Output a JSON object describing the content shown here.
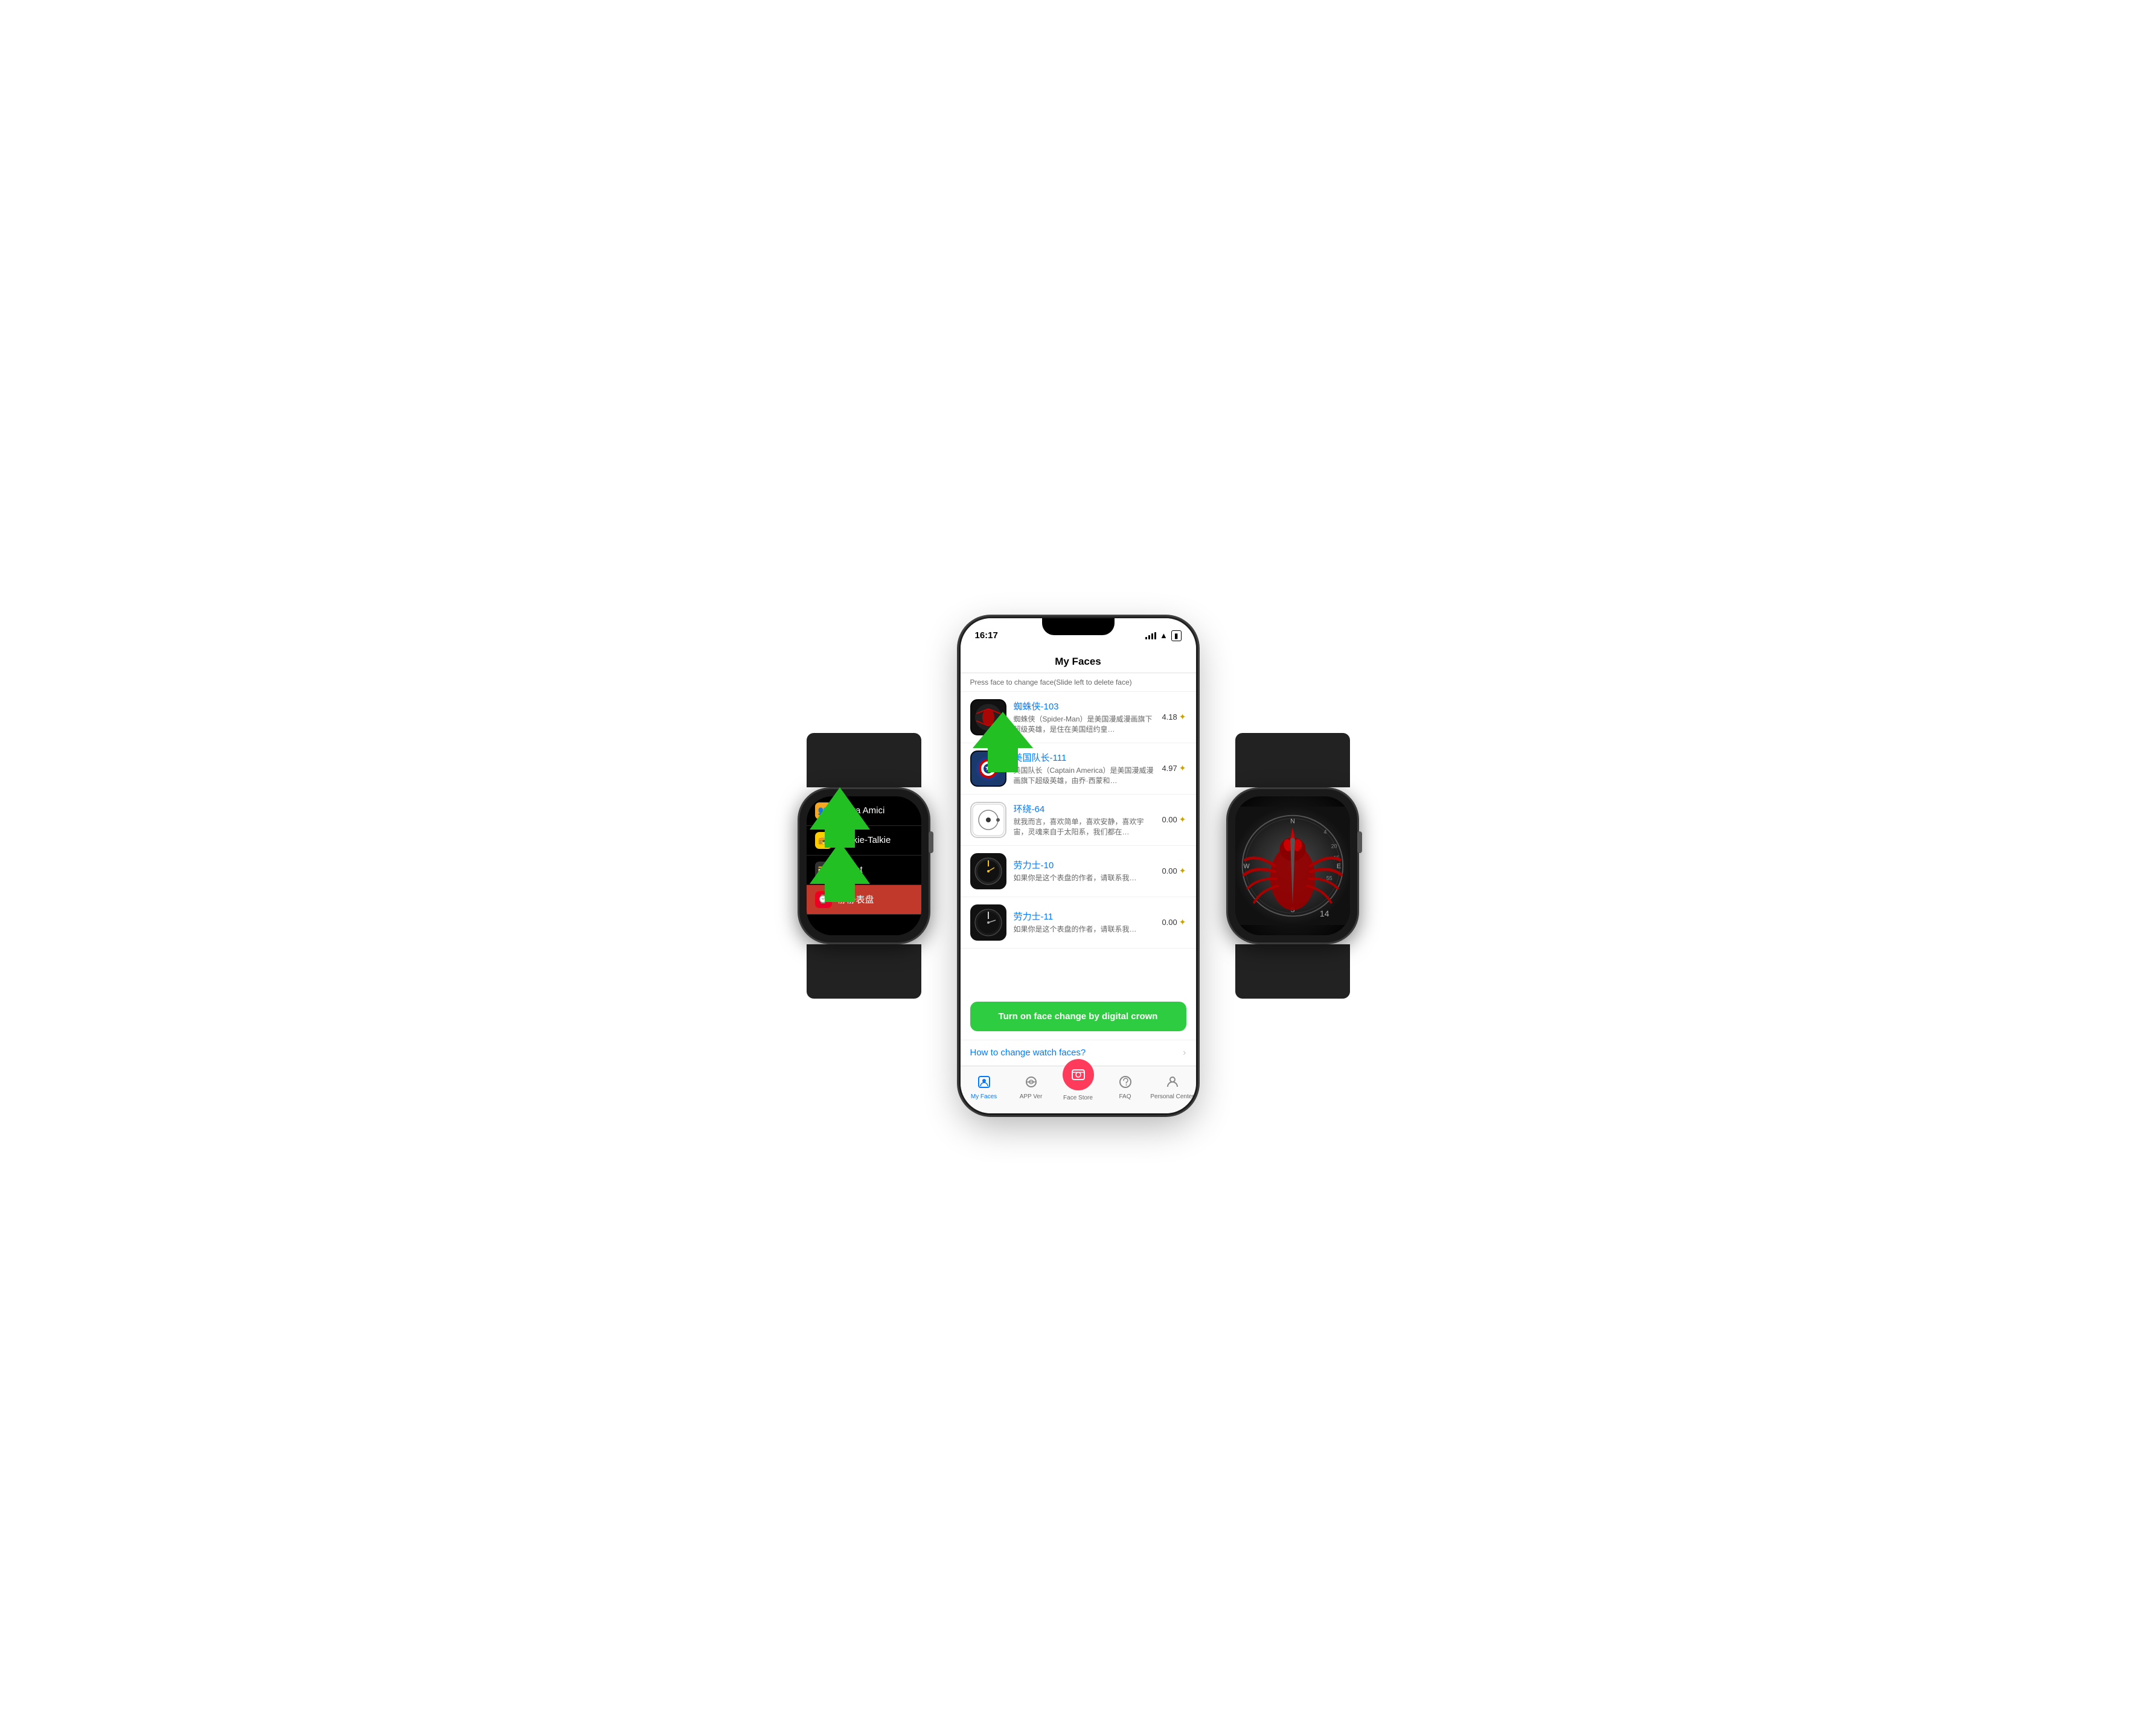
{
  "status_bar": {
    "time": "16:17",
    "signal": "●●●",
    "wifi": "wifi",
    "battery": "battery"
  },
  "page": {
    "title": "My Faces",
    "subtitle": "Press face to change face(Slide left to delete face)"
  },
  "faces": [
    {
      "id": 1,
      "title": "蜘蛛侠-103",
      "desc": "蜘蛛侠（Spider-Man）是美国漫威漫画旗下超级英雄，是住在美国纽约皇…",
      "rating": "4.18",
      "thumb_type": "spiderman"
    },
    {
      "id": 2,
      "title": "美国队长-111",
      "desc": "美国队长（Captain America）是美国漫威漫画旗下超级英雄，由乔·西蒙和…",
      "rating": "4.97",
      "thumb_type": "captain"
    },
    {
      "id": 3,
      "title": "环绕-64",
      "desc": "就我而言，喜欢简单，喜欢安静，喜欢宇宙，灵魂来自于太阳系，我们都在…",
      "rating": "0.00",
      "thumb_type": "orbit"
    },
    {
      "id": 4,
      "title": "劳力士-10",
      "desc": "如果你是这个表盘的作者，请联系我…",
      "rating": "0.00",
      "thumb_type": "rolex1"
    },
    {
      "id": 5,
      "title": "劳力士-11",
      "desc": "如果你是这个表盘的作者，请联系我…",
      "rating": "0.00",
      "thumb_type": "rolex2"
    }
  ],
  "action_button": {
    "label": "Turn on face change by digital crown"
  },
  "how_to_link": {
    "label": "How to change watch faces?"
  },
  "tab_bar": {
    "items": [
      {
        "id": "my-faces",
        "label": "My Faces",
        "active": true
      },
      {
        "id": "app-ver",
        "label": "APP Ver",
        "active": false
      },
      {
        "id": "face-store",
        "label": "Face Store",
        "active": false
      },
      {
        "id": "faq",
        "label": "FAQ",
        "active": false
      },
      {
        "id": "personal-center",
        "label": "Personal Center",
        "active": false
      }
    ]
  },
  "watch_left": {
    "menu_items": [
      {
        "label": "Trova Amici",
        "icon_color": "#f5a623",
        "icon": "👥",
        "active": false
      },
      {
        "label": "Walkie-Talkie",
        "icon_color": "#ffcc00",
        "icon": "📻",
        "active": false
      },
      {
        "label": "Wallet",
        "icon_color": "#000",
        "icon": "💳",
        "active": false
      },
      {
        "label": "静静表盘",
        "icon_color": "#e8002a",
        "icon": "⌚",
        "highlighted": true
      }
    ]
  },
  "watch_right": {
    "number": "14"
  }
}
